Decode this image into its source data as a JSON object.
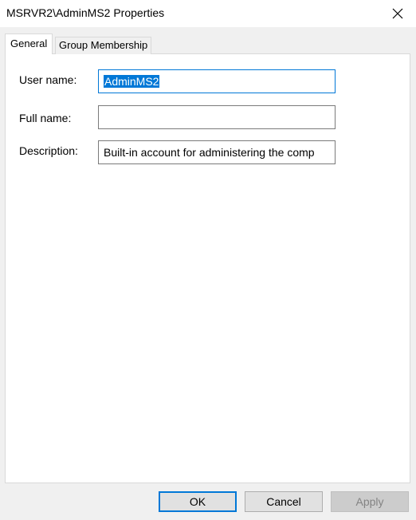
{
  "window": {
    "title": "MSRVR2\\AdminMS2 Properties"
  },
  "tabs": [
    {
      "label": "General",
      "active": true
    },
    {
      "label": "Group Membership",
      "active": false
    }
  ],
  "fields": {
    "user_name": {
      "label": "User name:",
      "value": "AdminMS2"
    },
    "full_name": {
      "label": "Full name:",
      "value": ""
    },
    "description": {
      "label": "Description:",
      "value": "Built-in account for administering the comp"
    }
  },
  "buttons": {
    "ok": "OK",
    "cancel": "Cancel",
    "apply": "Apply"
  },
  "colors": {
    "accent": "#0078d7",
    "dialog_bg": "#f0f0f0",
    "panel_bg": "#ffffff"
  },
  "icons": {
    "close": "close-icon"
  }
}
